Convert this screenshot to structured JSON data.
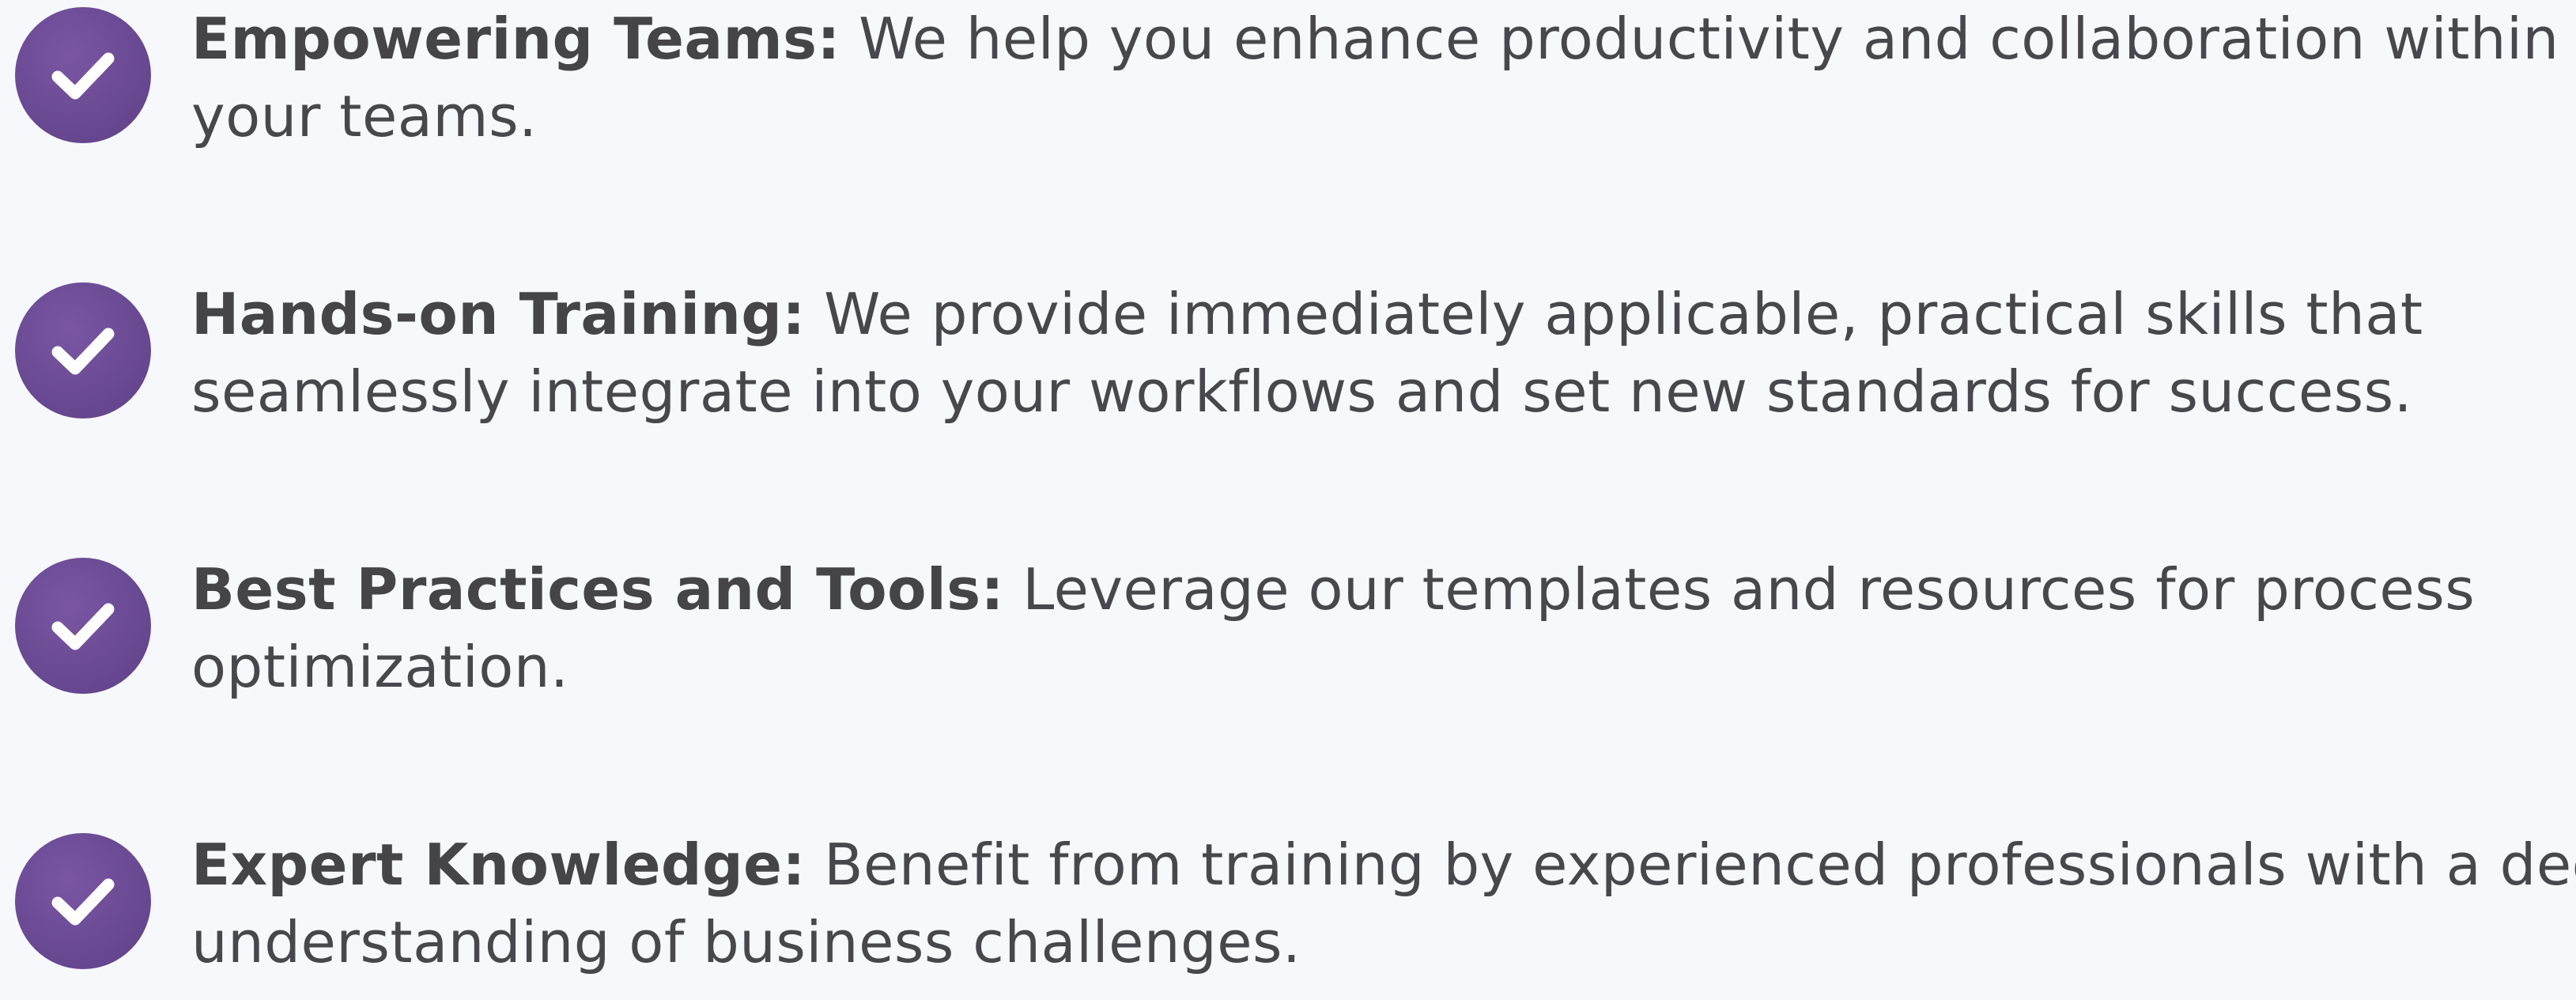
{
  "colors": {
    "background": "#f6f8fc",
    "accent": "#6a4a93",
    "text": "#48474d"
  },
  "features": [
    {
      "icon": "checkmark-circle-icon",
      "title": "Empowering Teams:",
      "line1": "We help you enhance productivity and collaboration within",
      "line2": "your teams."
    },
    {
      "icon": "checkmark-circle-icon",
      "title": "Hands-on Training:",
      "line1": "We provide immediately applicable, practical skills that",
      "line2": "seamlessly integrate into your workflows and set new standards for success."
    },
    {
      "icon": "checkmark-circle-icon",
      "title": "Best Practices and Tools:",
      "line1": "Leverage our templates and resources for process",
      "line2": "optimization."
    },
    {
      "icon": "checkmark-circle-icon",
      "title": "Expert Knowledge:",
      "line1": "Benefit from training by experienced professionals with a deep",
      "line2": "understanding of business challenges."
    }
  ]
}
